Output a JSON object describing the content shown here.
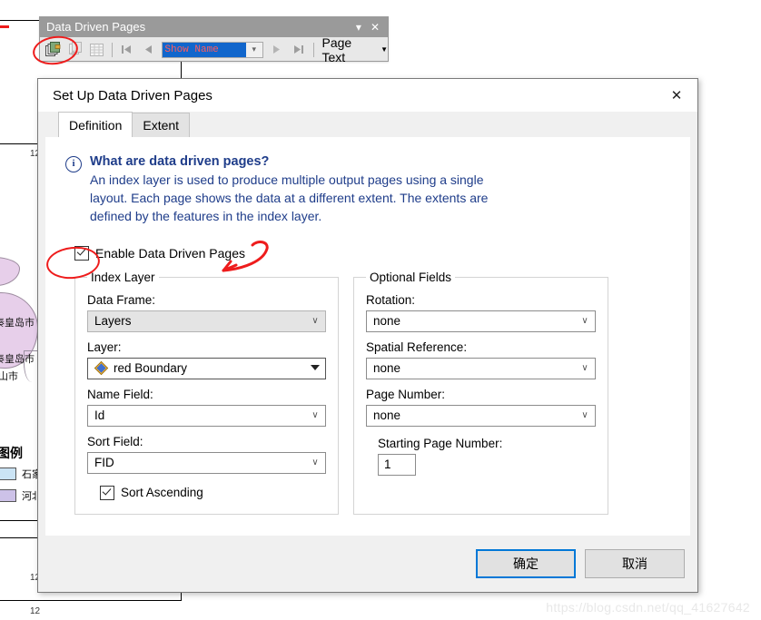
{
  "background": {
    "ruler_numbers": [
      "12",
      "12",
      "12"
    ],
    "map_labels": [
      "秦皇岛市",
      "秦皇岛市",
      "山市"
    ],
    "legend": {
      "title": "图例",
      "items": [
        {
          "label": "石家",
          "color": "#cbe4f5"
        },
        {
          "label": "河北",
          "color": "#cdc2e8"
        }
      ]
    }
  },
  "toolbar": {
    "title": "Data Driven Pages",
    "minimize_icon": "chevron-down-icon",
    "close_icon": "close-icon",
    "buttons": [
      {
        "name": "setup-data-driven-pages",
        "icon": "pages-setup-icon",
        "enabled": true
      },
      {
        "name": "refresh-pages",
        "icon": "refresh-pages-icon",
        "enabled": false
      },
      {
        "name": "page-table",
        "icon": "table-icon",
        "enabled": false
      }
    ],
    "nav": {
      "first_icon": "first-page-icon",
      "prev_icon": "previous-page-icon",
      "next_icon": "next-page-icon",
      "last_icon": "last-page-icon"
    },
    "page_combo_value": "Show  Name",
    "page_text_label": "Page Text",
    "page_text_caret": "caret-down-icon"
  },
  "dialog": {
    "title": "Set Up Data Driven Pages",
    "close_icon": "close-icon",
    "tabs": [
      {
        "label": "Definition",
        "active": true
      },
      {
        "label": "Extent",
        "active": false
      }
    ],
    "info": {
      "icon": "info-icon",
      "heading": "What are data driven pages?",
      "body": "An index layer is used to produce multiple output pages using a single layout.   Each page shows the data at a different extent.  The extents are defined by the features in the index layer."
    },
    "enable_checkbox": {
      "label": "Enable Data Driven Pages",
      "checked": true
    },
    "index_layer": {
      "group_label": "Index Layer",
      "data_frame_label": "Data Frame:",
      "data_frame_value": "Layers",
      "layer_label": "Layer:",
      "layer_value": "red  Boundary",
      "layer_symbol": "polygon-symbol-icon",
      "name_field_label": "Name Field:",
      "name_field_value": "Id",
      "sort_field_label": "Sort Field:",
      "sort_field_value": "FID",
      "sort_ascending_label": "Sort Ascending",
      "sort_ascending_checked": true
    },
    "optional_fields": {
      "group_label": "Optional Fields",
      "rotation_label": "Rotation:",
      "rotation_value": "none",
      "spatial_reference_label": "Spatial Reference:",
      "spatial_reference_value": "none",
      "page_number_label": "Page Number:",
      "page_number_value": "none",
      "starting_page_number_label": "Starting Page Number:",
      "starting_page_number_value": "1"
    },
    "footer": {
      "ok_label": "确定",
      "cancel_label": "取消"
    }
  },
  "annotations": {
    "accent_color": "#ee1c1c"
  },
  "watermark": "https://blog.csdn.net/qq_41627642"
}
